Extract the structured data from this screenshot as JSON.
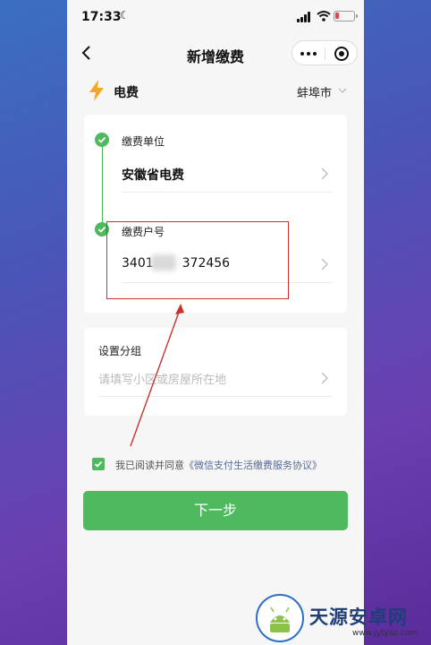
{
  "status_bar": {
    "time": "17:33"
  },
  "nav": {
    "title": "新增缴费"
  },
  "bill": {
    "type": "电费",
    "city": "蚌埠市"
  },
  "form": {
    "unit_label": "缴费单位",
    "unit_value": "安徽省电费",
    "account_label": "缴费户号",
    "account_prefix": "3401",
    "account_suffix": "372456",
    "group_label": "设置分组",
    "group_placeholder": "请填写小区或房屋所在地"
  },
  "agreement": {
    "checked": true,
    "prefix": "我已阅读并同意",
    "link": "《微信支付生活缴费服务协议》"
  },
  "next_button": "下一步",
  "watermark": {
    "title": "天源安卓网",
    "url": "www.jytyaz.com"
  },
  "colors": {
    "accent_green": "#4fb95d",
    "link_blue": "#576b95",
    "annotation_red": "#c8332b",
    "bolt_orange": "#f5a623"
  },
  "icons": [
    "back-icon",
    "more-icon",
    "target-icon",
    "bolt-icon",
    "chevron-down-icon",
    "check-icon",
    "chevron-right-icon"
  ]
}
